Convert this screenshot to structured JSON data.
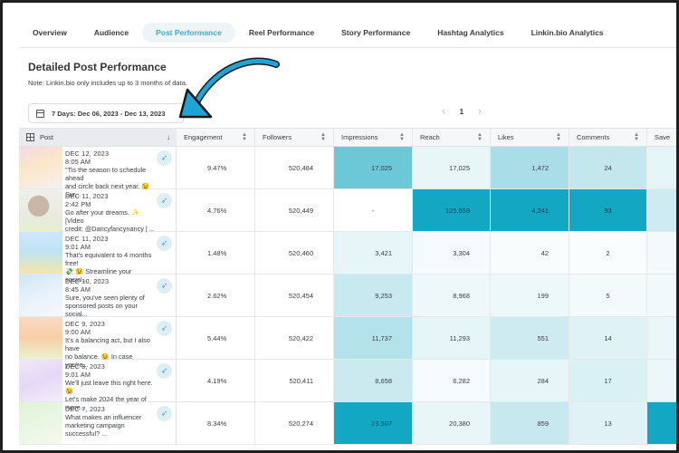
{
  "tabs": [
    {
      "label": "Overview",
      "active": false
    },
    {
      "label": "Audience",
      "active": false
    },
    {
      "label": "Post Performance",
      "active": true
    },
    {
      "label": "Reel Performance",
      "active": false
    },
    {
      "label": "Story Performance",
      "active": false
    },
    {
      "label": "Hashtag Analytics",
      "active": false
    },
    {
      "label": "Linkin.bio Analytics",
      "active": false
    }
  ],
  "page": {
    "title": "Detailed Post Performance",
    "note": "Note: Linkin.bio only includes up to 3 months of data."
  },
  "date_range": "7 Days: Dec 06, 2023 - Dec 13, 2023",
  "pagination": {
    "current": "1",
    "prev_icon": "chevron-left-icon",
    "next_icon": "chevron-right-icon"
  },
  "columns": {
    "post": "Post",
    "engagement": "Engagement",
    "followers": "Followers",
    "impressions": "Impressions",
    "reach": "Reach",
    "likes": "Likes",
    "comments": "Comments",
    "saves": "Save"
  },
  "rows": [
    {
      "date": "DEC 12, 2023",
      "time": "8:05 AM",
      "caption1": "\"Tis the season to schedule ahead",
      "caption2": "and circle back next year. 😉 Sur...",
      "engagement": "9.47%",
      "followers": "520,484",
      "impressions": "17,025",
      "reach": "17,025",
      "likes": "1,472",
      "comments": "24"
    },
    {
      "date": "DEC 11, 2023",
      "time": "2:42 PM",
      "caption1": "Go after your dreams. ✨ [Video",
      "caption2": "credit: @Dancyfancynancy | ...",
      "engagement": "4.76%",
      "followers": "520,449",
      "impressions": "-",
      "reach": "125,559",
      "likes": "4,241",
      "comments": "93"
    },
    {
      "date": "DEC 11, 2023",
      "time": "9:01 AM",
      "caption1": "That's equivalent to 4 months free!",
      "caption2": "💸 😉 Streamline your social...",
      "engagement": "1.48%",
      "followers": "520,460",
      "impressions": "3,421",
      "reach": "3,304",
      "likes": "42",
      "comments": "2"
    },
    {
      "date": "DEC 10, 2023",
      "time": "8:45 AM",
      "caption1": "Sure, you've seen plenty of",
      "caption2": "sponsored posts on your social...",
      "engagement": "2.62%",
      "followers": "520,454",
      "impressions": "9,253",
      "reach": "8,968",
      "likes": "199",
      "comments": "5"
    },
    {
      "date": "DEC 9, 2023",
      "time": "9:00 AM",
      "caption1": "It's a balancing act, but I also have",
      "caption2": "no balance. 😉 In case you're...",
      "engagement": "5.44%",
      "followers": "520,422",
      "impressions": "11,737",
      "reach": "11,293",
      "likes": "551",
      "comments": "14"
    },
    {
      "date": "DEC 8, 2023",
      "time": "9:01 AM",
      "caption1": "We'll just leave this right here. 😉",
      "caption2": "Let's make 2024 the year of more...",
      "engagement": "4.19%",
      "followers": "520,411",
      "impressions": "8,658",
      "reach": "6,282",
      "likes": "284",
      "comments": "17"
    },
    {
      "date": "DEC 7, 2023",
      "time": "",
      "caption1": "What makes an influencer",
      "caption2": "marketing campaign successful? ...",
      "engagement": "8.34%",
      "followers": "520,274",
      "impressions": "23,507",
      "reach": "20,380",
      "likes": "859",
      "comments": "13"
    }
  ],
  "heat_colors": {
    "impressions": [
      "#6cc7d6",
      "#ffffff",
      "#e6f5f8",
      "#c7e9ef",
      "#b3e2ea",
      "#cbeaf0",
      "#14a7c3"
    ],
    "reach": [
      "#e9f6f8",
      "#14a7c3",
      "#f5fbfc",
      "#eef8fa",
      "#e5f5f8",
      "#f5fbfc",
      "#e9f6f8"
    ],
    "likes": [
      "#a9ddE7",
      "#14a7c3",
      "#f7fcfd",
      "#edf8fa",
      "#cdebf1",
      "#e6f5f8",
      "#c6e8ee"
    ],
    "comments": [
      "#c4e7ed",
      "#14a7c3",
      "#fafdfd",
      "#f3fafb",
      "#dff2f6",
      "#d9f0f4",
      "#e0f2f6"
    ],
    "saves": [
      "#e4f4f7",
      "#cdebf1",
      "#f4fafb",
      "#f1f9fa",
      "#eaf6f8",
      "#ecf7f9",
      "#14a7c3"
    ]
  },
  "accent_color": "#4aa6c9",
  "annotation_arrow_color": "#1fa4d6"
}
